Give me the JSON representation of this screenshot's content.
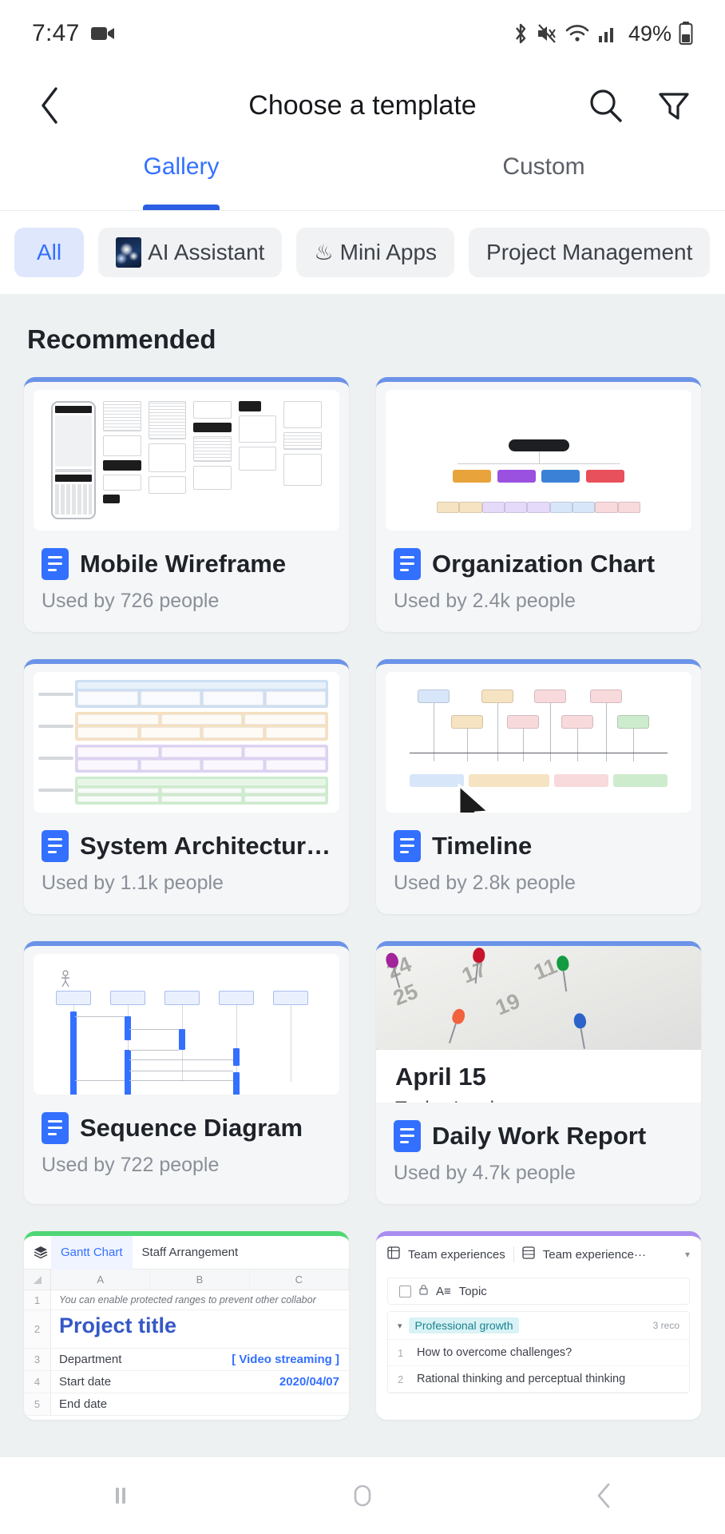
{
  "status_bar": {
    "time": "7:47",
    "battery_percent": "49%",
    "icons": [
      "video-camera-icon",
      "bluetooth-icon",
      "mute-icon",
      "wifi-icon",
      "cellular-signal-icon",
      "battery-icon"
    ]
  },
  "app_bar": {
    "title": "Choose a template",
    "back_icon": "chevron-left-icon",
    "search_icon": "search-icon",
    "filter_icon": "filter-icon"
  },
  "tabs": [
    {
      "label": "Gallery",
      "active": true
    },
    {
      "label": "Custom",
      "active": false
    }
  ],
  "chips": [
    {
      "label": "All",
      "selected": true,
      "icon": ""
    },
    {
      "label": "AI Assistant",
      "selected": false,
      "icon": "ai-sparkle-image"
    },
    {
      "label": "Mini Apps",
      "selected": false,
      "icon": "♨"
    },
    {
      "label": "Project Management",
      "selected": false,
      "icon": ""
    }
  ],
  "section": {
    "title": "Recommended"
  },
  "cards": [
    {
      "title": "Mobile Wireframe",
      "usage": "Used by 726 people",
      "accent": "#6b93e8"
    },
    {
      "title": "Organization Chart",
      "usage": "Used by 2.4k people",
      "accent": "#6b93e8"
    },
    {
      "title": "System Architecture ...",
      "usage": "Used by 1.1k people",
      "accent": "#6b93e8"
    },
    {
      "title": "Timeline",
      "usage": "Used by 2.8k people",
      "accent": "#6b93e8"
    },
    {
      "title": "Sequence Diagram",
      "usage": "Used by 722 people",
      "accent": "#6b93e8"
    },
    {
      "title": "Daily Work Report",
      "usage": "Used by 4.7k people",
      "accent": "#6b93e8"
    }
  ],
  "daily_report_preview": {
    "date_title": "April 15",
    "subtitle": "Today's plan"
  },
  "gantt_preview": {
    "tabs": [
      "Gantt Chart",
      "Staff Arrangement"
    ],
    "columns": [
      "A",
      "B",
      "C"
    ],
    "rows": [
      {
        "num": "1",
        "text": "You can enable protected ranges to prevent other collabor"
      },
      {
        "num": "2",
        "text": "Project title"
      },
      {
        "num": "3",
        "key": "Department",
        "value": "[ Video streaming ]"
      },
      {
        "num": "4",
        "key": "Start date",
        "value": "2020/04/07"
      },
      {
        "num": "5",
        "key": "End date",
        "value": ""
      }
    ]
  },
  "team_preview": {
    "tab_primary": "Team experiences",
    "tab_secondary": "Team experience···",
    "header_field": "Topic",
    "group_label": "Professional growth",
    "group_count": "3 reco",
    "items": [
      {
        "num": "1",
        "text": "How to overcome challenges?"
      },
      {
        "num": "2",
        "text": "Rational thinking and perceptual thinking"
      }
    ]
  },
  "nav_bar": {
    "recents_icon": "recents-icon",
    "home_icon": "home-icon",
    "back_icon": "nav-back-icon"
  },
  "colors": {
    "accent_blue": "#3370ff",
    "tab_underline": "#2b5fe3",
    "page_bg": "#eef1f2",
    "card_bg": "#f5f6f7",
    "org_orange": "#e8a33a",
    "org_purple": "#9b51e0",
    "org_blue": "#3b82d6",
    "org_red": "#e8505b",
    "gantt_accent": "#4fd675",
    "team_accent": "#a98df0"
  }
}
